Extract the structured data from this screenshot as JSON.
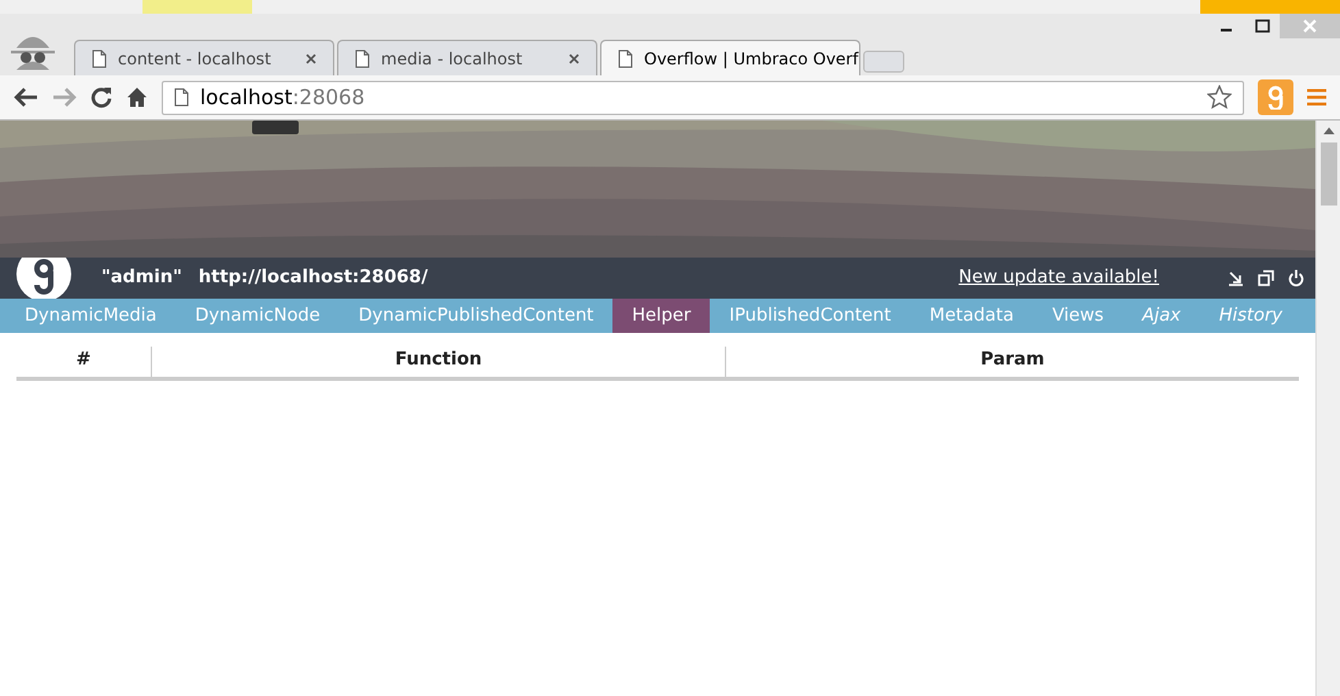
{
  "browser": {
    "tabs": [
      {
        "title": "content - localhost",
        "selected": false
      },
      {
        "title": "media - localhost",
        "selected": false
      },
      {
        "title": "Overflow | Umbraco Overf",
        "selected": true
      }
    ],
    "address": {
      "host": "localhost",
      "port": ":28068"
    }
  },
  "glimpse": {
    "user": "\"admin\"",
    "url": "http://localhost:28068/",
    "update_link": "New update available!",
    "tabs": [
      {
        "label": "DynamicMedia",
        "selected": false,
        "italic": false
      },
      {
        "label": "DynamicNode",
        "selected": false,
        "italic": false
      },
      {
        "label": "DynamicPublishedContent",
        "selected": false,
        "italic": false
      },
      {
        "label": "Helper",
        "selected": true,
        "italic": false
      },
      {
        "label": "IPublishedContent",
        "selected": false,
        "italic": false
      },
      {
        "label": "Metadata",
        "selected": false,
        "italic": false
      },
      {
        "label": "Views",
        "selected": false,
        "italic": false
      },
      {
        "label": "Ajax",
        "selected": false,
        "italic": true
      },
      {
        "label": "History",
        "selected": false,
        "italic": true
      }
    ]
  },
  "table": {
    "columns": [
      "#",
      "Function",
      "Param"
    ]
  }
}
